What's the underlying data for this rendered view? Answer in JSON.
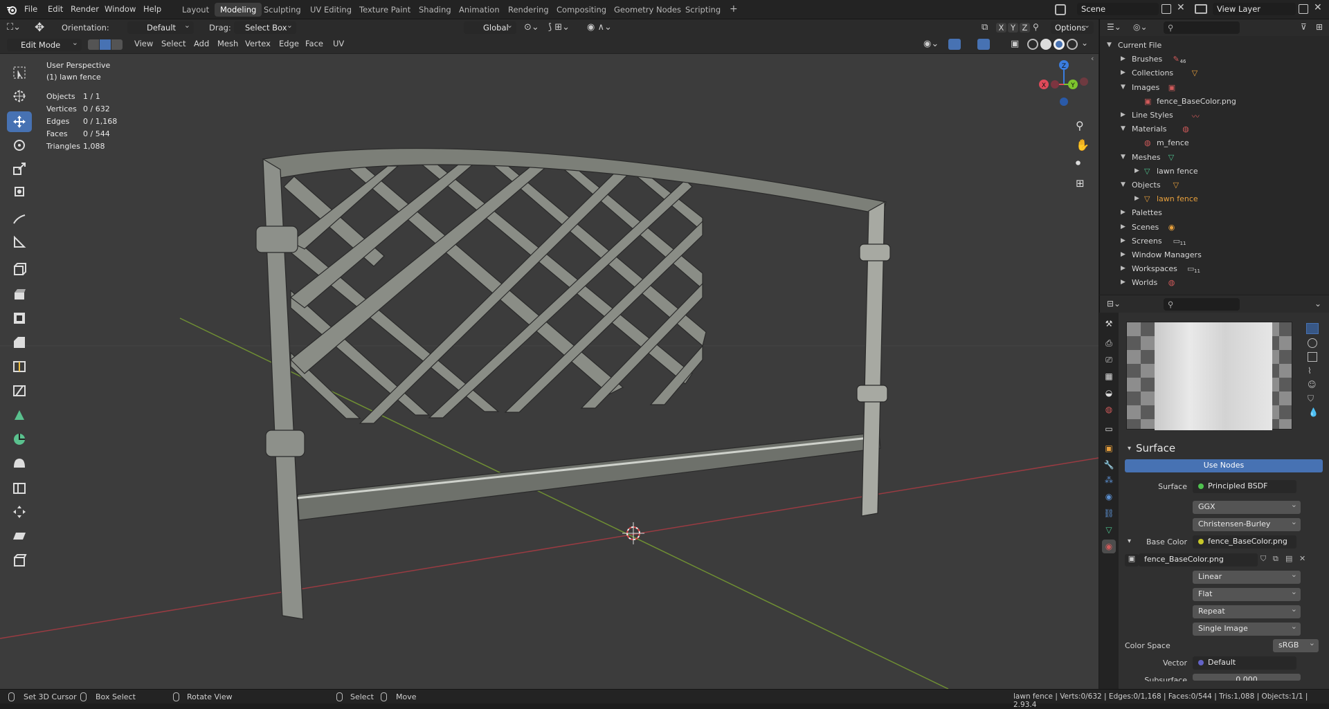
{
  "topbar": {
    "menus": [
      "File",
      "Edit",
      "Render",
      "Window",
      "Help"
    ],
    "workspaces": [
      "Layout",
      "Modeling",
      "Sculpting",
      "UV Editing",
      "Texture Paint",
      "Shading",
      "Animation",
      "Rendering",
      "Compositing",
      "Geometry Nodes",
      "Scripting"
    ],
    "active_workspace": "Modeling",
    "add_tab": "+",
    "scene": "Scene",
    "view_layer": "View Layer"
  },
  "viewport_header": {
    "orientation_label": "Orientation:",
    "orientation_value": "Default",
    "drag_label": "Drag:",
    "drag_value": "Select Box",
    "transform_orientation": "Global",
    "axes": [
      "X",
      "Y",
      "Z"
    ],
    "options": "Options",
    "mode": "Edit Mode",
    "menus": [
      "View",
      "Select",
      "Add",
      "Mesh",
      "Vertex",
      "Edge",
      "Face",
      "UV"
    ]
  },
  "overlay": {
    "view_name": "User Perspective",
    "object_name": "(1) lawn fence",
    "stats": [
      {
        "label": "Objects",
        "value": "1 / 1"
      },
      {
        "label": "Vertices",
        "value": "0 / 632"
      },
      {
        "label": "Edges",
        "value": "0 / 1,168"
      },
      {
        "label": "Faces",
        "value": "0 / 544"
      },
      {
        "label": "Triangles",
        "value": "1,088"
      }
    ],
    "gizmo_axes": [
      "X",
      "Y",
      "Z"
    ]
  },
  "outliner": {
    "rows": [
      {
        "label": "Current File",
        "level": 0,
        "expanded": true,
        "icon": "file-icon"
      },
      {
        "label": "Brushes",
        "level": 1,
        "expanded": false,
        "icon": "brush-icon",
        "badge": "46"
      },
      {
        "label": "Collections",
        "level": 1,
        "expanded": false,
        "icon": "collection-icon"
      },
      {
        "label": "Images",
        "level": 1,
        "expanded": true,
        "icon": "image-icon"
      },
      {
        "label": "fence_BaseColor.png",
        "level": 2,
        "expanded": null,
        "icon": "image-icon"
      },
      {
        "label": "Line Styles",
        "level": 1,
        "expanded": false,
        "icon": "linestyle-icon"
      },
      {
        "label": "Materials",
        "level": 1,
        "expanded": true,
        "icon": "material-icon"
      },
      {
        "label": "m_fence",
        "level": 2,
        "expanded": null,
        "icon": "material-icon"
      },
      {
        "label": "Meshes",
        "level": 1,
        "expanded": true,
        "icon": "mesh-icon"
      },
      {
        "label": "lawn fence",
        "level": 2,
        "expanded": false,
        "icon": "mesh-icon"
      },
      {
        "label": "Objects",
        "level": 1,
        "expanded": true,
        "icon": "object-icon"
      },
      {
        "label": "lawn fence",
        "level": 2,
        "expanded": false,
        "icon": "object-icon",
        "highlight": true
      },
      {
        "label": "Palettes",
        "level": 1,
        "expanded": false,
        "icon": "palette-icon"
      },
      {
        "label": "Scenes",
        "level": 1,
        "expanded": false,
        "icon": "scene-icon"
      },
      {
        "label": "Screens",
        "level": 1,
        "expanded": false,
        "icon": "screen-icon",
        "badge": "11"
      },
      {
        "label": "Window Managers",
        "level": 1,
        "expanded": false,
        "icon": "window-icon"
      },
      {
        "label": "Workspaces",
        "level": 1,
        "expanded": false,
        "icon": "workspace-icon",
        "badge": "11"
      },
      {
        "label": "Worlds",
        "level": 1,
        "expanded": false,
        "icon": "world-icon"
      }
    ]
  },
  "properties": {
    "section": "Surface",
    "use_nodes": "Use Nodes",
    "surface_label": "Surface",
    "surface_value": "Principled BSDF",
    "distribution": "GGX",
    "subsurface_method": "Christensen-Burley",
    "base_color_label": "Base Color",
    "base_color_value": "fence_BaseColor.png",
    "image_name": "fence_BaseColor.png",
    "interpolation": "Linear",
    "projection": "Flat",
    "extension": "Repeat",
    "source": "Single Image",
    "color_space_label": "Color Space",
    "color_space_value": "sRGB",
    "vector_label": "Vector",
    "vector_value": "Default",
    "subsurface_label": "Subsurface",
    "subsurface_value": "0.000"
  },
  "statusbar": {
    "items": [
      "Set 3D Cursor",
      "Box Select",
      "Rotate View",
      "Select",
      "Move"
    ],
    "info": "lawn fence | Verts:0/632 | Edges:0/1,168 | Faces:0/544 | Tris:1,088 | Objects:1/1 | 2.93.4"
  },
  "colors": {
    "accent": "#4772b3",
    "axis_x": "#e04a5a",
    "axis_y": "#7dc52d",
    "axis_z": "#3a7de0",
    "object_orange": "#e8a03c",
    "node_socket_yellow": "#c7c729",
    "node_socket_green": "#4ec14e",
    "vector_socket": "#6363c7"
  }
}
